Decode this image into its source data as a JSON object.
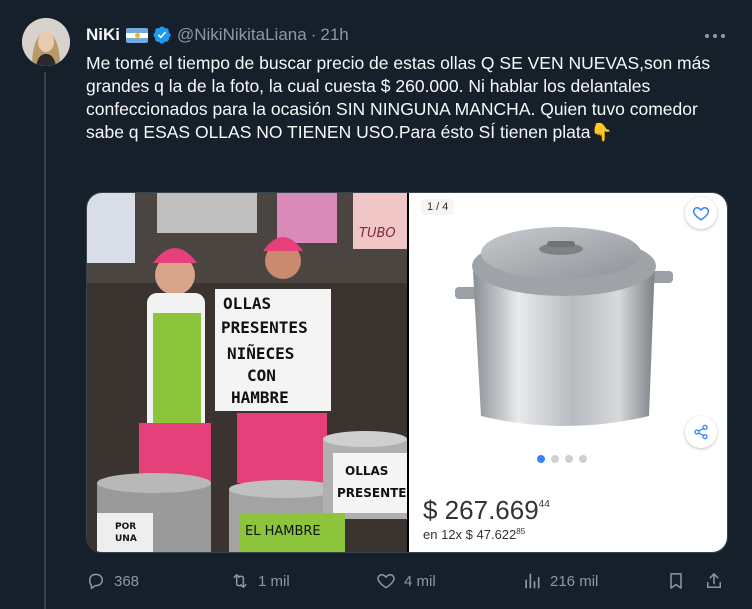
{
  "author": {
    "display_name": "NiKi",
    "handle": "@NikiNikitaLiana",
    "separator": "·",
    "time": "21h",
    "flag_icon": "argentina-flag-icon",
    "verified_icon": "verified-badge-icon"
  },
  "tweet": {
    "text": "Me tomé el tiempo de buscar precio de estas ollas Q SE VEN NUEVAS,son más grandes q la de la foto, la cual cuesta $ 260.000. Ni hablar los delantales confeccionados para la ocasión SIN NINGUNA MANCHA. Quien tuvo comedor sabe q ESAS OLLAS NO TIENEN USO.Para ésto SÍ tienen plata👇"
  },
  "media": {
    "photo_signs": {
      "main_sign_1": "OLLAS",
      "main_sign_2": "PRESENTES",
      "main_sign_3": "NIÑECES",
      "main_sign_4": "CON",
      "main_sign_5": "HAMBRE",
      "pot_sign_1": "OLLAS",
      "pot_sign_2": "PRESENTES",
      "bottom_sign": "EL HAMBRE",
      "small_sign_1": "POR",
      "small_sign_2": "UNA",
      "top_sign": "TUBO"
    },
    "product": {
      "counter": "1 / 4",
      "price_main": "$ 267.669",
      "price_cents": "44",
      "installments_prefix": "en 12x ",
      "installments_amount": "$ 47.622",
      "installments_cents": "85",
      "favorite_icon": "heart-outline-icon",
      "share_icon": "share-icon"
    }
  },
  "actions": {
    "replies": "368",
    "retweets": "1 mil",
    "likes": "4 mil",
    "views": "216 mil"
  },
  "colors": {
    "background": "#15202b",
    "text": "#f7f9f9",
    "muted": "#8b98a5",
    "verified": "#1d9bf0",
    "carousel_active": "#3483fa"
  }
}
